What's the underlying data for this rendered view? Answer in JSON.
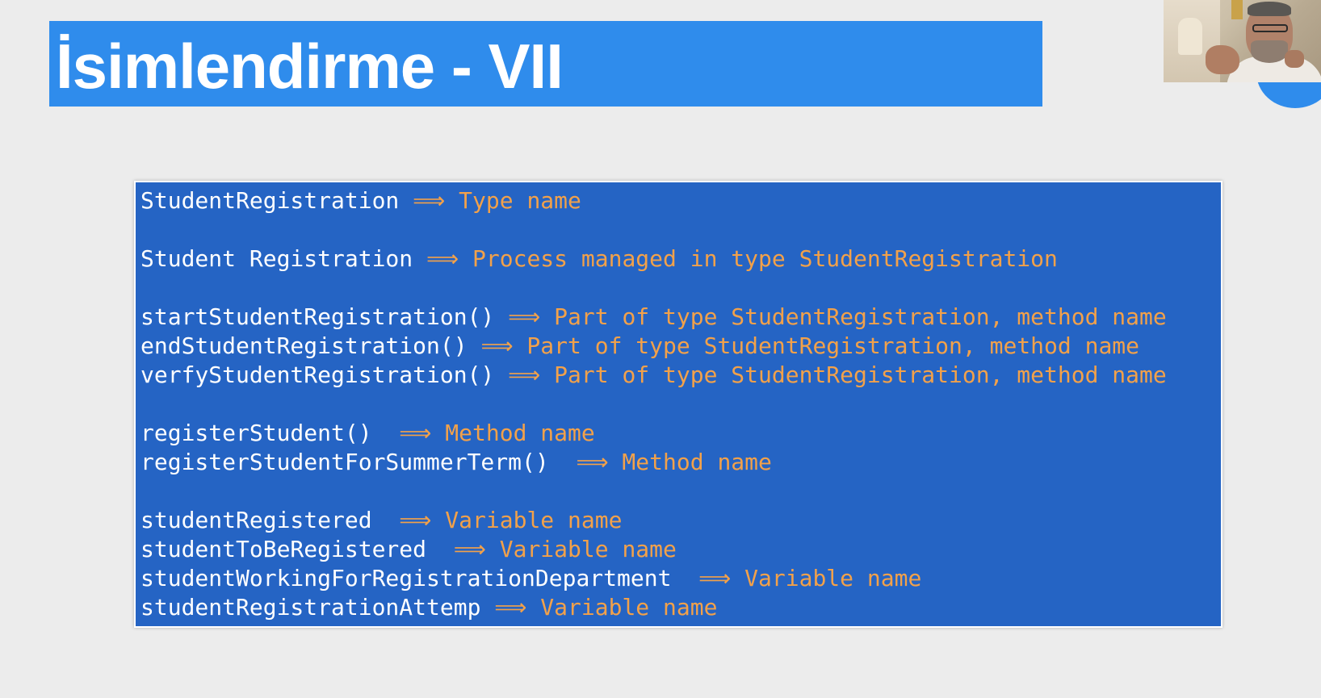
{
  "slide": {
    "title": "İsimlendirme - VII",
    "colors": {
      "background": "#ececec",
      "title_bar": "#2f8cec",
      "code_panel": "#2564c4",
      "identifier": "#ffffff",
      "description": "#f2a14a"
    },
    "lines": [
      {
        "ident": "StudentRegistration ",
        "arrow": "⟹",
        "desc": " Type name"
      },
      {
        "gap": true
      },
      {
        "ident": "Student Registration ",
        "arrow": "⟹",
        "desc": " Process managed in type StudentRegistration"
      },
      {
        "gap": true
      },
      {
        "ident": "startStudentRegistration() ",
        "arrow": "⟹",
        "desc": " Part of type StudentRegistration, method name"
      },
      {
        "ident": "endStudentRegistration() ",
        "arrow": "⟹",
        "desc": " Part of type StudentRegistration, method name"
      },
      {
        "ident": "verfyStudentRegistration() ",
        "arrow": "⟹",
        "desc": " Part of type StudentRegistration, method name"
      },
      {
        "gap": true
      },
      {
        "ident": "registerStudent()  ",
        "arrow": "⟹",
        "desc": " Method name"
      },
      {
        "ident": "registerStudentForSummerTerm()  ",
        "arrow": "⟹",
        "desc": " Method name"
      },
      {
        "gap": true
      },
      {
        "ident": "studentRegistered  ",
        "arrow": "⟹",
        "desc": " Variable name"
      },
      {
        "ident": "studentToBeRegistered  ",
        "arrow": "⟹",
        "desc": " Variable name"
      },
      {
        "ident": "studentWorkingForRegistrationDepartment  ",
        "arrow": "⟹",
        "desc": " Variable name"
      },
      {
        "ident": "studentRegistrationAttemp ",
        "arrow": "⟹",
        "desc": " Variable name"
      }
    ]
  },
  "webcam": {
    "icon": "presenter-webcam"
  }
}
